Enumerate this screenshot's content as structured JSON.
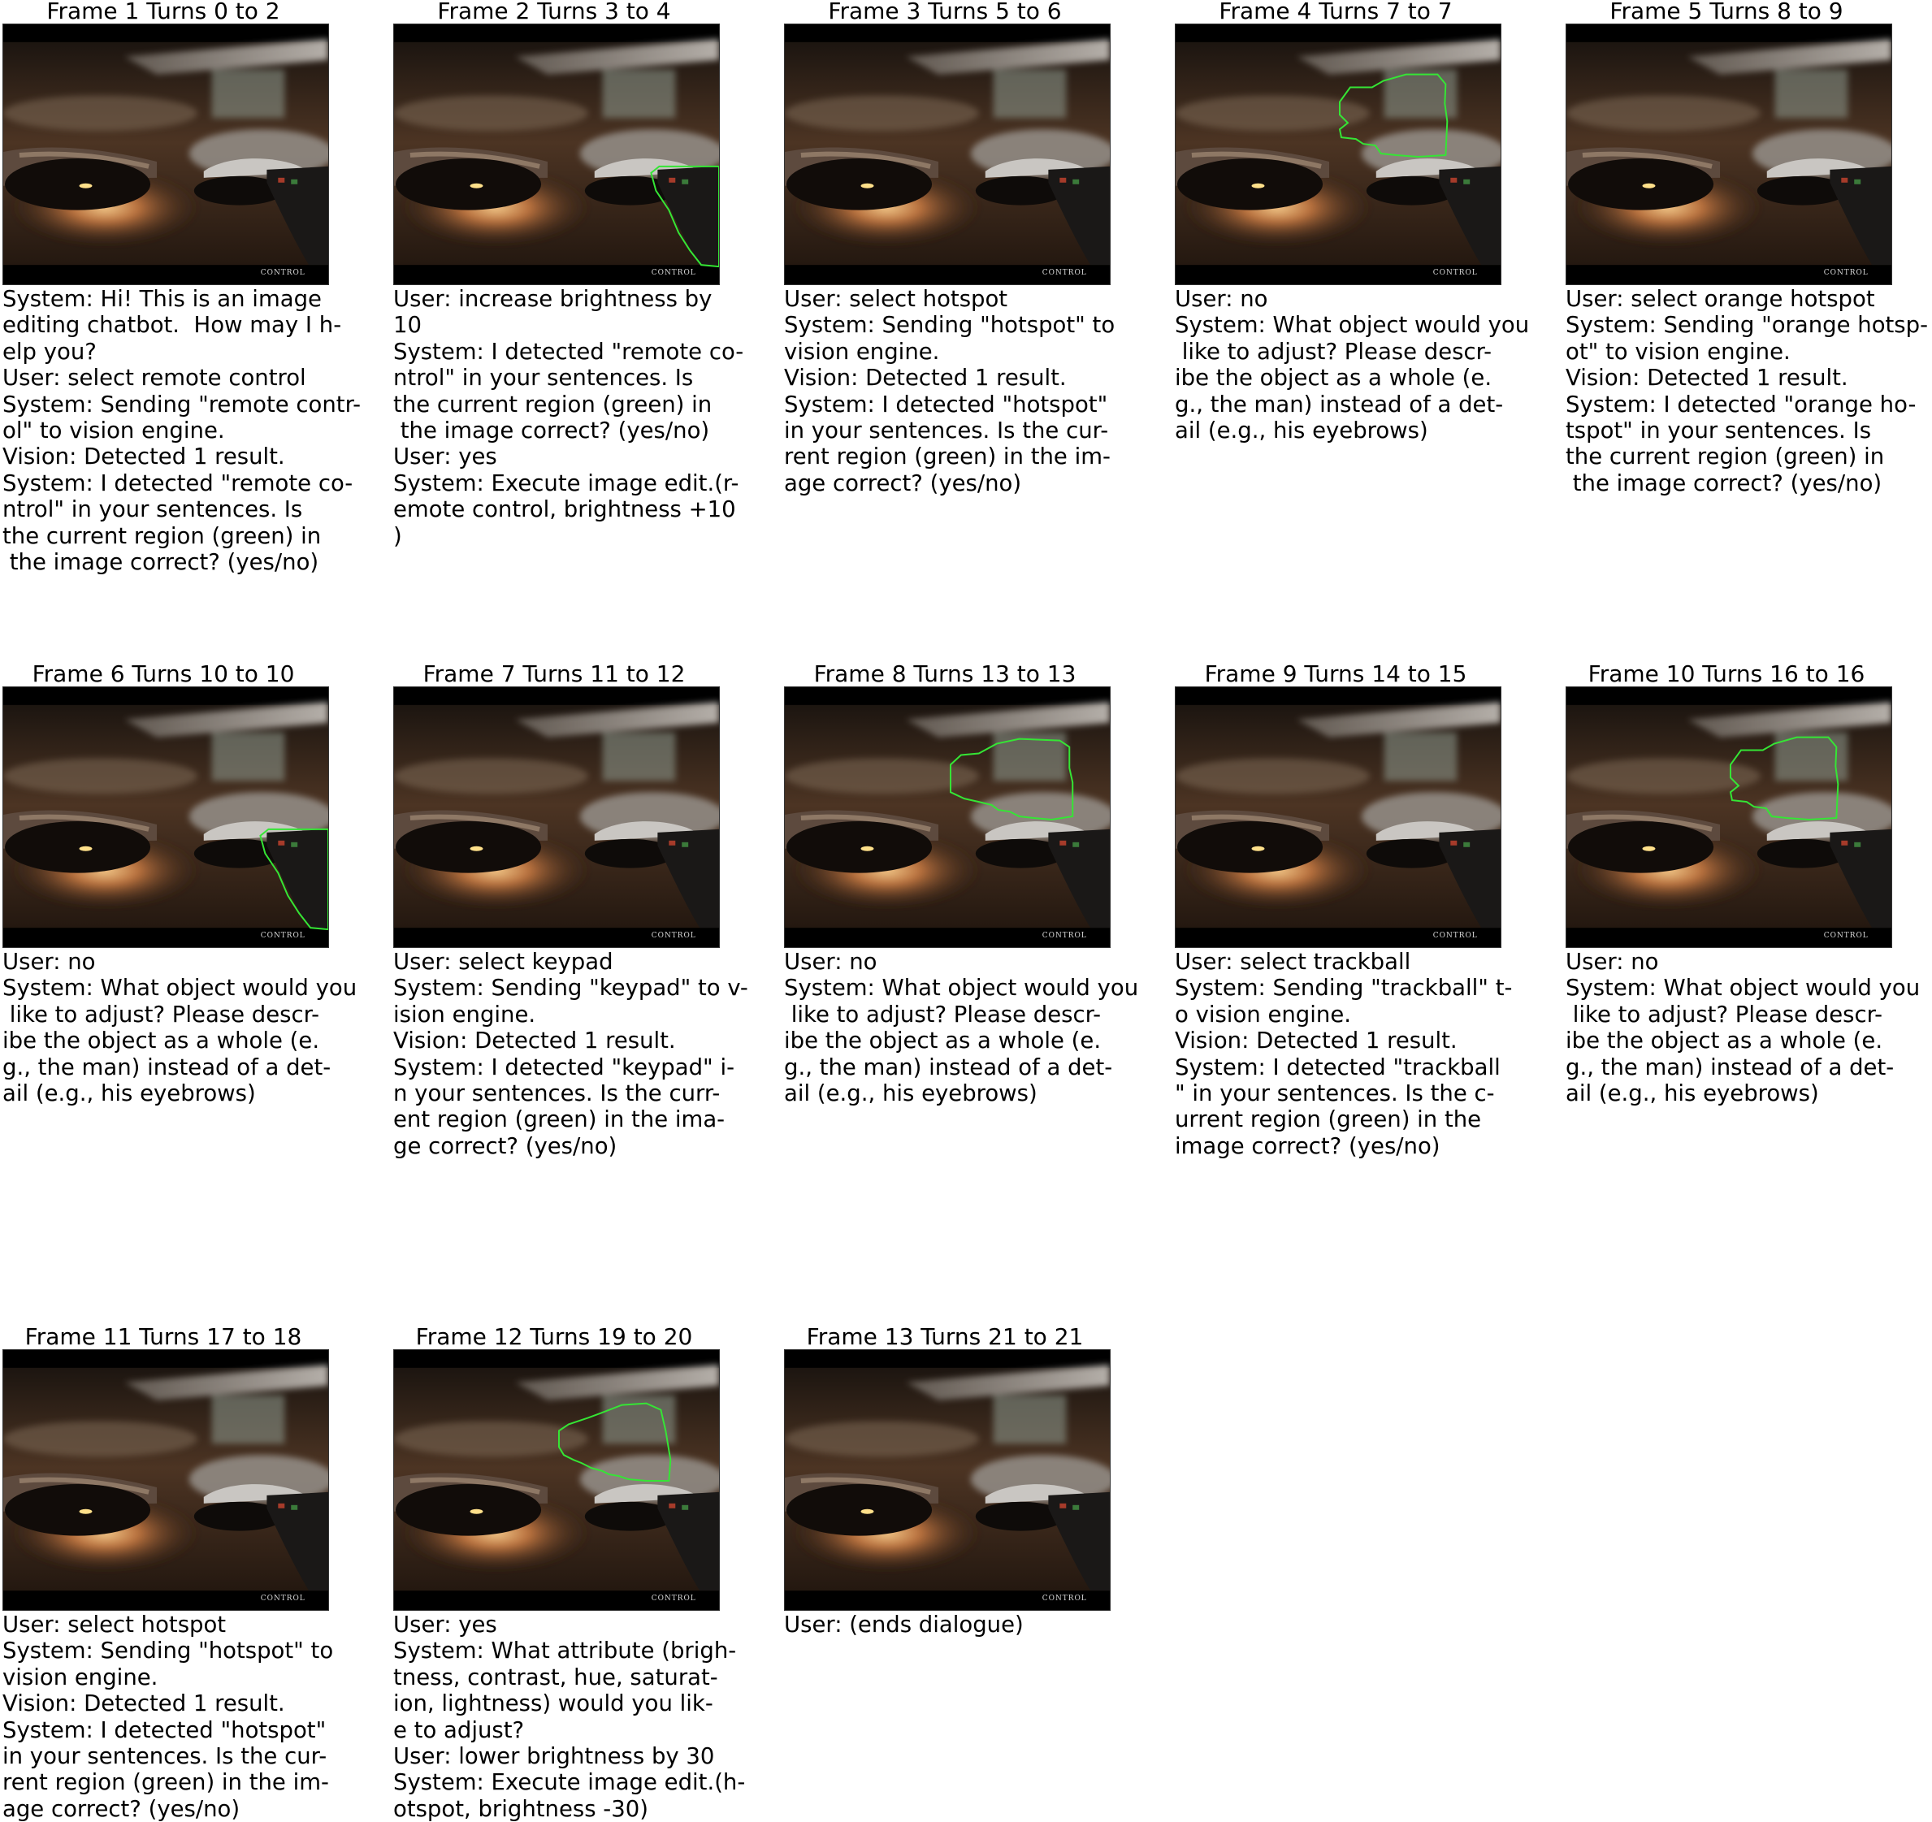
{
  "frames": [
    {
      "title": "Frame 1 Turns 0 to 2",
      "overlay": "none",
      "watermark": "CONTROL",
      "lines": [
        "System: Hi! This is an image",
        "editing chatbot.  How may I h-",
        "elp you?",
        "User: select remote control",
        "System: Sending \"remote contr-",
        "ol\" to vision engine.",
        "Vision: Detected 1 result.",
        "System: I detected \"remote co-",
        "ntrol\" in your sentences. Is",
        "the current region (green) in",
        " the image correct? (yes/no)"
      ]
    },
    {
      "title": "Frame 2 Turns 3 to 4",
      "overlay": "remote",
      "watermark": "CONTROL",
      "lines": [
        "User: increase brightness by",
        "10",
        "System: I detected \"remote co-",
        "ntrol\" in your sentences. Is",
        "the current region (green) in",
        " the image correct? (yes/no)",
        "User: yes",
        "System: Execute image edit.(r-",
        "emote control, brightness +10",
        ")"
      ]
    },
    {
      "title": "Frame 3 Turns 5 to 6",
      "overlay": "none",
      "watermark": "CONTROL",
      "lines": [
        "User: select hotspot",
        "System: Sending \"hotspot\" to",
        "vision engine.",
        "Vision: Detected 1 result.",
        "System: I detected \"hotspot\"",
        "in your sentences. Is the cur-",
        "rent region (green) in the im-",
        "age correct? (yes/no)"
      ]
    },
    {
      "title": "Frame 4 Turns 7 to 7",
      "overlay": "hotspot",
      "watermark": "CONTROL",
      "lines": [
        "User: no",
        "System: What object would you",
        " like to adjust? Please descr-",
        "ibe the object as a whole (e.",
        "g., the man) instead of a det-",
        "ail (e.g., his eyebrows)"
      ]
    },
    {
      "title": "Frame 5 Turns 8 to 9",
      "overlay": "none",
      "watermark": "CONTROL",
      "lines": [
        "User: select orange hotspot",
        "System: Sending \"orange hotsp-",
        "ot\" to vision engine.",
        "Vision: Detected 1 result.",
        "System: I detected \"orange ho-",
        "tspot\" in your sentences. Is",
        "the current region (green) in",
        " the image correct? (yes/no)"
      ]
    },
    {
      "title": "Frame 6 Turns 10 to 10",
      "overlay": "remote",
      "watermark": "CONTROL",
      "lines": [
        "User: no",
        "System: What object would you",
        " like to adjust? Please descr-",
        "ibe the object as a whole (e.",
        "g., the man) instead of a det-",
        "ail (e.g., his eyebrows)"
      ]
    },
    {
      "title": "Frame 7 Turns 11 to 12",
      "overlay": "none",
      "watermark": "CONTROL",
      "lines": [
        "User: select keypad",
        "System: Sending \"keypad\" to v-",
        "ision engine.",
        "Vision: Detected 1 result.",
        "System: I detected \"keypad\" i-",
        "n your sentences. Is the curr-",
        "ent region (green) in the ima-",
        "ge correct? (yes/no)"
      ]
    },
    {
      "title": "Frame 8 Turns 13 to 13",
      "overlay": "hotspot2",
      "watermark": "CONTROL",
      "lines": [
        "User: no",
        "System: What object would you",
        " like to adjust? Please descr-",
        "ibe the object as a whole (e.",
        "g., the man) instead of a det-",
        "ail (e.g., his eyebrows)"
      ]
    },
    {
      "title": "Frame 9 Turns 14 to 15",
      "overlay": "none",
      "watermark": "CONTROL",
      "lines": [
        "User: select trackball",
        "System: Sending \"trackball\" t-",
        "o vision engine.",
        "Vision: Detected 1 result.",
        "System: I detected \"trackball",
        "\" in your sentences. Is the c-",
        "urrent region (green) in the",
        "image correct? (yes/no)"
      ]
    },
    {
      "title": "Frame 10 Turns 16 to 16",
      "overlay": "hotspot",
      "watermark": "CONTROL",
      "lines": [
        "User: no",
        "System: What object would you",
        " like to adjust? Please descr-",
        "ibe the object as a whole (e.",
        "g., the man) instead of a det-",
        "ail (e.g., his eyebrows)"
      ]
    },
    {
      "title": "Frame 11 Turns 17 to 18",
      "overlay": "none",
      "watermark": "CONTROL",
      "lines": [
        "User: select hotspot",
        "System: Sending \"hotspot\" to",
        "vision engine.",
        "Vision: Detected 1 result.",
        "System: I detected \"hotspot\"",
        "in your sentences. Is the cur-",
        "rent region (green) in the im-",
        "age correct? (yes/no)"
      ]
    },
    {
      "title": "Frame 12 Turns 19 to 20",
      "overlay": "hotspot3",
      "watermark": "CONTROL",
      "lines": [
        "User: yes",
        "System: What attribute (brigh-",
        "tness, contrast, hue, saturat-",
        "ion, lightness) would you lik-",
        "e to adjust?",
        "User: lower brightness by 30",
        "System: Execute image edit.(h-",
        "otspot, brightness -30)"
      ]
    },
    {
      "title": "Frame 13 Turns 21 to 21",
      "overlay": "none",
      "watermark": "CONTROL",
      "lines": [
        "User: (ends dialogue)"
      ]
    }
  ]
}
